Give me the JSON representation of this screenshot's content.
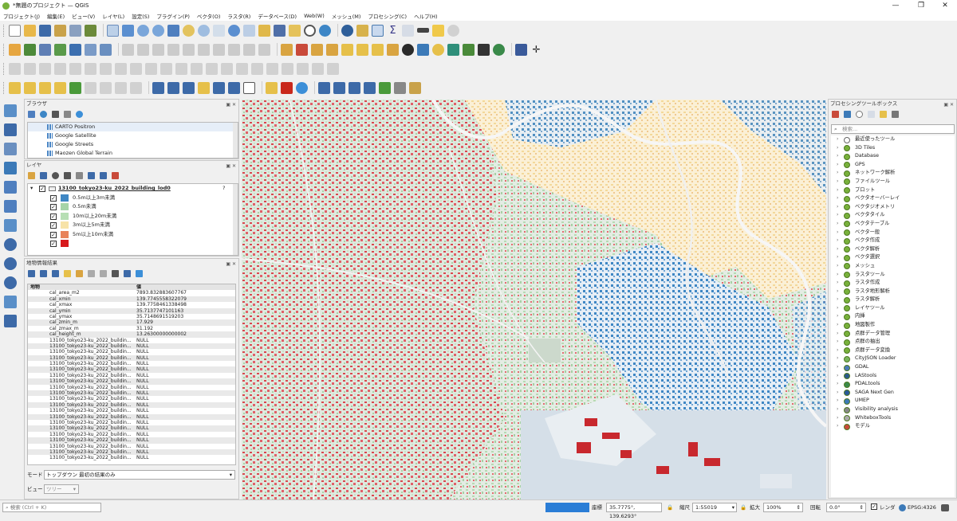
{
  "window": {
    "title": "*無題のプロジェクト — QGIS",
    "controls": [
      "—",
      "❐",
      "✕"
    ]
  },
  "menu": [
    "プロジェクト(J)",
    "編集(E)",
    "ビュー(V)",
    "レイヤ(L)",
    "設定(S)",
    "プラグイン(P)",
    "ベクタ(O)",
    "ラスタ(R)",
    "データベース(D)",
    "Web(W)",
    "メッシュ(M)",
    "プロセシング(C)",
    "ヘルプ(H)"
  ],
  "browser": {
    "title": "ブラウザ",
    "items": [
      "CARTO Positron",
      "Google Satellite",
      "Google Streets",
      "Maozen Global Terrain"
    ]
  },
  "layers": {
    "title": "レイヤ",
    "layer_name": "13100_tokyo23-ku_2022_building_lod0",
    "classes": [
      {
        "label": "0.5m以上3m未満",
        "color": "#3f87c4"
      },
      {
        "label": "0.5m未満",
        "color": "#a6d4a8"
      },
      {
        "label": "10m以上20m未満",
        "color": "#b7dfb4"
      },
      {
        "label": "3m以上5m未満",
        "color": "#f7e3a8"
      },
      {
        "label": "5m以上10m未満",
        "color": "#e8825a"
      },
      {
        "label": "",
        "color": "#d7191c"
      }
    ]
  },
  "identify": {
    "title": "地物情報結果",
    "col_feature": "地物",
    "col_value": "値",
    "rows": [
      [
        "cal_area_m2",
        "7893.832883607767"
      ],
      [
        "cal_xmin",
        "139.7745558322079"
      ],
      [
        "cal_xmax",
        "139.7758461338498"
      ],
      [
        "cal_ymin",
        "35.7137747101163"
      ],
      [
        "cal_ymax",
        "35.7148691519203"
      ],
      [
        "cal_zmin_m",
        "17.929"
      ],
      [
        "cal_zmax_m",
        "31.192"
      ],
      [
        "cal_height_m",
        "13.26300000000002"
      ],
      [
        "13100_tokyo23-ku_2022_buildin...",
        "NULL"
      ],
      [
        "13100_tokyo23-ku_2022_buildin...",
        "NULL"
      ],
      [
        "13100_tokyo23-ku_2022_buildin...",
        "NULL"
      ],
      [
        "13100_tokyo23-ku_2022_buildin...",
        "NULL"
      ],
      [
        "13100_tokyo23-ku_2022_buildin...",
        "NULL"
      ],
      [
        "13100_tokyo23-ku_2022_buildin...",
        "NULL"
      ],
      [
        "13100_tokyo23-ku_2022_buildin...",
        "NULL"
      ],
      [
        "13100_tokyo23-ku_2022_buildin...",
        "NULL"
      ],
      [
        "13100_tokyo23-ku_2022_buildin...",
        "NULL"
      ],
      [
        "13100_tokyo23-ku_2022_buildin...",
        "NULL"
      ],
      [
        "13100_tokyo23-ku_2022_buildin...",
        "NULL"
      ],
      [
        "13100_tokyo23-ku_2022_buildin...",
        "NULL"
      ],
      [
        "13100_tokyo23-ku_2022_buildin...",
        "NULL"
      ],
      [
        "13100_tokyo23-ku_2022_buildin...",
        "NULL"
      ],
      [
        "13100_tokyo23-ku_2022_buildin...",
        "NULL"
      ],
      [
        "13100_tokyo23-ku_2022_buildin...",
        "NULL"
      ],
      [
        "13100_tokyo23-ku_2022_buildin...",
        "NULL"
      ],
      [
        "13100_tokyo23-ku_2022_buildin...",
        "NULL"
      ],
      [
        "13100_tokyo23-ku_2022_buildin...",
        "NULL"
      ],
      [
        "13100_tokyo23-ku_2022_buildin...",
        "NULL"
      ],
      [
        "13100_tokyo23-ku_2022_buildin...",
        "NULL"
      ]
    ],
    "mode_label": "モード",
    "mode_value": "トップダウン 最初の結果のみ",
    "view_label": "ビュー",
    "view_value": "ツリー"
  },
  "processing": {
    "title": "プロセシングツールボックス",
    "search_placeholder": "検索...",
    "items": [
      "最近使ったツール",
      "3D Tiles",
      "Database",
      "GPS",
      "ネットワーク解析",
      "ファイルツール",
      "プロット",
      "ベクタオーバーレイ",
      "ベクタジオメトリ",
      "ベクタタイル",
      "ベクタテーブル",
      "ベクター般",
      "ベクタ作成",
      "ベクタ解析",
      "ベクタ選択",
      "メッシュ",
      "ラスタツール",
      "ラスタ作成",
      "ラスタ地形解析",
      "ラスタ解析",
      "レイヤツール",
      "内挿",
      "地図製作",
      "点群データ管理",
      "点群の抽出",
      "点群データ変換",
      "CityJSON Loader",
      "GDAL",
      "LAStools",
      "PDALtools",
      "SAGA Next Gen",
      "UMEP",
      "Visibility analysis",
      "WhiteboxTools",
      "モデル"
    ]
  },
  "status": {
    "locate_placeholder": "検索 (Ctrl + K)",
    "coord_label": "座標",
    "coord_value": "35.7775°, 139.6293°",
    "scale_label": "縮尺",
    "scale_value": "1:55019",
    "magnifier_label": "拡大",
    "magnifier_value": "100%",
    "rotation_label": "回転",
    "rotation_value": "0.0°",
    "render_label": "レンダ",
    "crs_value": "EPSG:4326"
  },
  "colors": {
    "accent": "#3c8fd8",
    "qgis_green": "#78b13b"
  }
}
